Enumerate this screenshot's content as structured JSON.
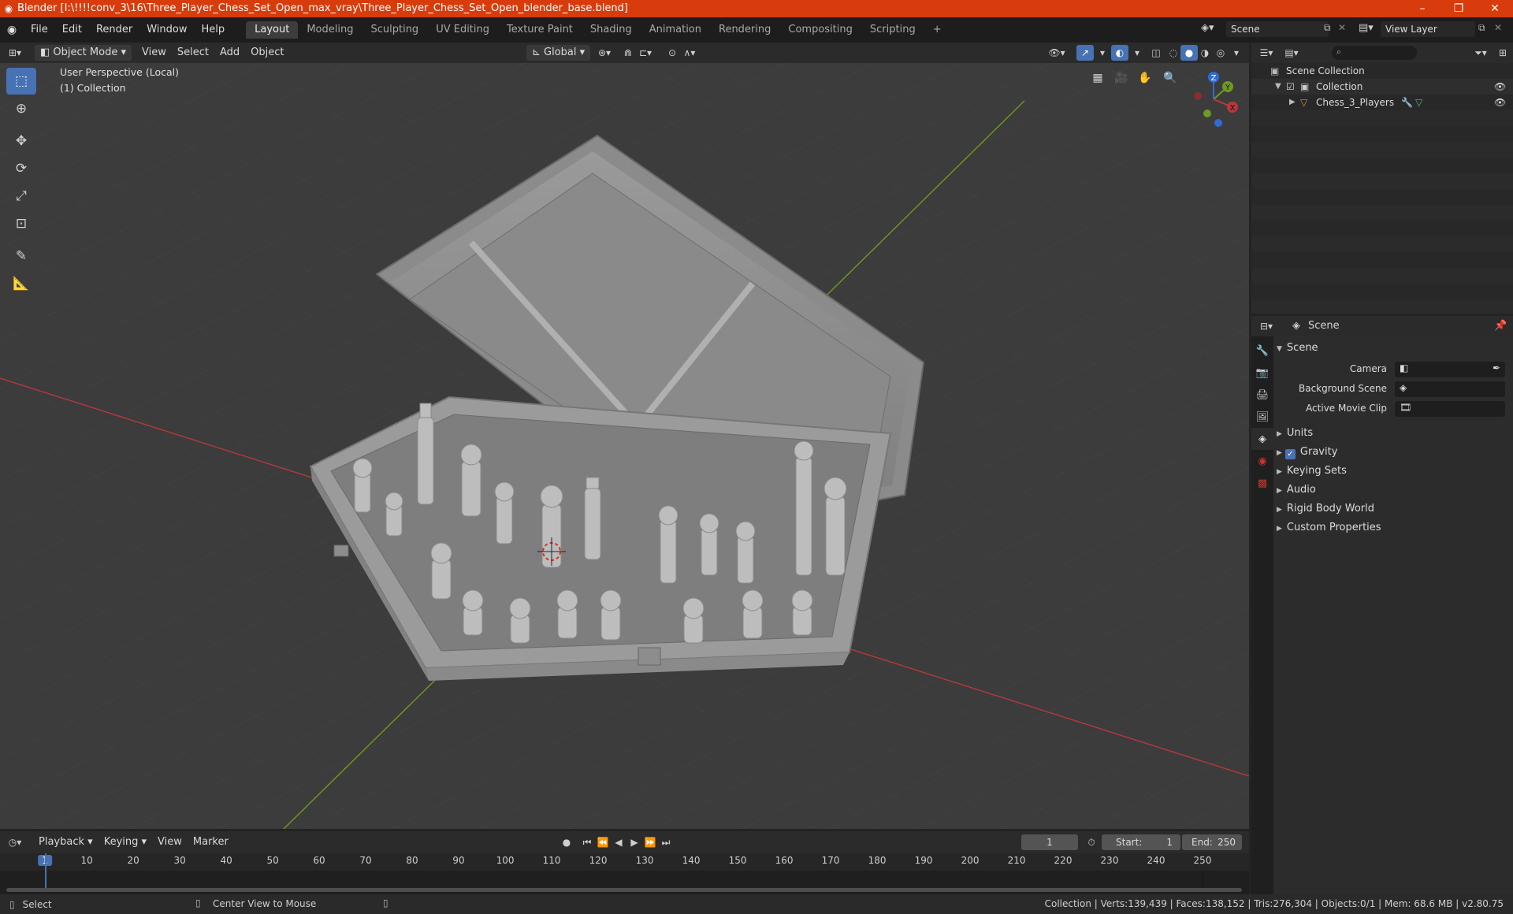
{
  "window": {
    "title": "Blender [I:\\!!!!conv_3\\16\\Three_Player_Chess_Set_Open_max_vray\\Three_Player_Chess_Set_Open_blender_base.blend]",
    "minimize": "–",
    "restore": "❐",
    "close": "✕"
  },
  "menu": [
    "File",
    "Edit",
    "Render",
    "Window",
    "Help"
  ],
  "workspaces": [
    "Layout",
    "Modeling",
    "Sculpting",
    "UV Editing",
    "Texture Paint",
    "Shading",
    "Animation",
    "Rendering",
    "Compositing",
    "Scripting"
  ],
  "workspace_add": "+",
  "scene_field": "Scene",
  "view_layer_field": "View Layer",
  "viewport_header": {
    "mode": "Object Mode",
    "view": "View",
    "select": "Select",
    "add": "Add",
    "object": "Object",
    "transform_orientation": "Global"
  },
  "viewport": {
    "perspective": "User Perspective (Local)",
    "collection": "(1) Collection",
    "gizmo": {
      "x": "X",
      "y": "Y",
      "z": "Z"
    }
  },
  "tools": [
    "select-box",
    "cursor",
    "move",
    "rotate",
    "scale",
    "transform",
    "annotate",
    "measure"
  ],
  "timeline_header": {
    "playback": "Playback",
    "keying": "Keying",
    "view": "View",
    "marker": "Marker",
    "current_frame": "1",
    "start_label": "Start:",
    "start_value": "1",
    "end_label": "End:",
    "end_value": "250"
  },
  "timeline_ruler": [
    "1",
    "10",
    "20",
    "30",
    "40",
    "50",
    "60",
    "70",
    "80",
    "90",
    "100",
    "110",
    "120",
    "130",
    "140",
    "150",
    "160",
    "170",
    "180",
    "190",
    "200",
    "210",
    "220",
    "230",
    "240",
    "250"
  ],
  "outliner": {
    "search_placeholder": "",
    "rows": [
      {
        "label": "Scene Collection"
      },
      {
        "label": "Collection"
      },
      {
        "label": "Chess_3_Players"
      }
    ]
  },
  "properties": {
    "header_title": "Scene",
    "panel_scene": "Scene",
    "camera_label": "Camera",
    "background_scene_label": "Background Scene",
    "active_movie_clip_label": "Active Movie Clip",
    "panels": [
      "Units",
      "Gravity",
      "Keying Sets",
      "Audio",
      "Rigid Body World",
      "Custom Properties"
    ]
  },
  "statusbar": {
    "select": "Select",
    "center_view": "Center View to Mouse",
    "stats": "Collection | Verts:139,439 | Faces:138,152 | Tris:276,304 | Objects:0/1 | Mem: 68.6 MB | v2.80.75"
  },
  "colors": {
    "title_bar": "#d83c0c",
    "accent": "#4772b3",
    "viewport_bg": "#3c3c3c",
    "x_axis": "#b8383a",
    "y_axis": "#6c9a23",
    "z_axis": "#2f6bd1"
  }
}
